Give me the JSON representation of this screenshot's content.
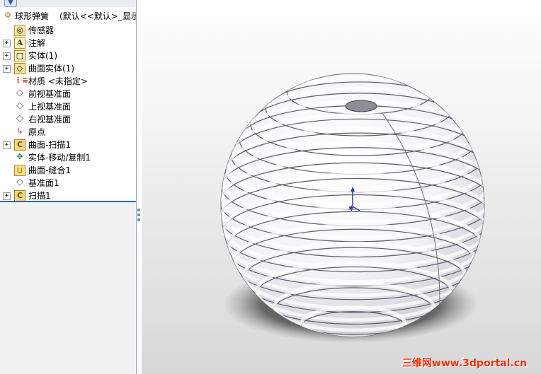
{
  "tree": {
    "root_label": "球形弹簧",
    "root_config": "(默认<<默认>_显示状",
    "items": [
      {
        "label": "传感器",
        "icon": "sensor-icon",
        "expandable": false
      },
      {
        "label": "注解",
        "icon": "annotation-icon",
        "expandable": true
      },
      {
        "label": "实体(1)",
        "icon": "solid-body-icon",
        "expandable": true
      },
      {
        "label": "曲面实体(1)",
        "icon": "surface-body-icon",
        "expandable": true
      },
      {
        "label": "材质 <未指定>",
        "icon": "material-icon",
        "expandable": false
      },
      {
        "label": "前视基准面",
        "icon": "plane-icon",
        "expandable": false
      },
      {
        "label": "上视基准面",
        "icon": "plane-icon",
        "expandable": false
      },
      {
        "label": "右视基准面",
        "icon": "plane-icon",
        "expandable": false
      },
      {
        "label": "原点",
        "icon": "origin-icon",
        "expandable": false
      },
      {
        "label": "曲面-扫描1",
        "icon": "sweep-icon",
        "expandable": true
      },
      {
        "label": "实体-移动/复制1",
        "icon": "move-copy-icon",
        "expandable": false
      },
      {
        "label": "曲面-缝合1",
        "icon": "knit-icon",
        "expandable": false
      },
      {
        "label": "基准面1",
        "icon": "plane-icon",
        "expandable": false
      },
      {
        "label": "扫描1",
        "icon": "sweep-icon",
        "expandable": true
      }
    ]
  },
  "viewport": {
    "watermark": "三维网www.3dportal.cn"
  },
  "colors": {
    "selection_line": "#2f63b8",
    "watermark": "#ff2a00",
    "triad_axis": "#1f3fb0"
  }
}
